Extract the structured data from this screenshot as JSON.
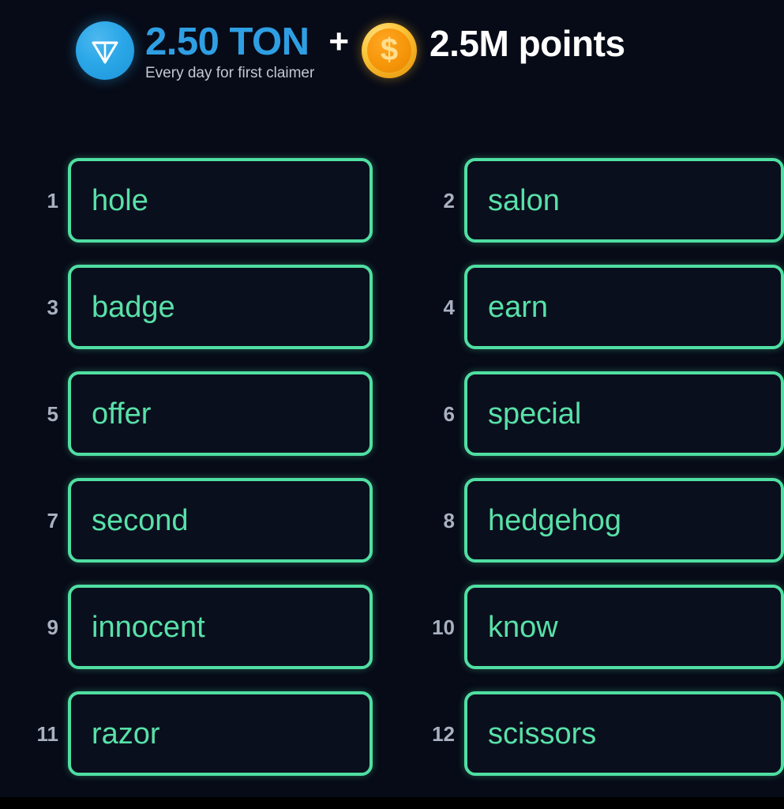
{
  "banner": {
    "ton_icon": "ton-coin-icon",
    "ton_amount": "2.50 TON",
    "ton_subtitle": "Every day for first claimer",
    "plus": "+",
    "coin_icon": "gold-coin-icon",
    "coin_symbol": "$",
    "points_amount": "2.5M points",
    "colors": {
      "ton_blue": "#2f9fe4",
      "coin_gold": "#f5a81a",
      "points_white": "#ffffff",
      "subtitle_gray": "#c3c8d4"
    }
  },
  "grid": {
    "accent_green": "#4fdfa2",
    "text_green": "#58e1a8",
    "index_gray": "#a9b0c0",
    "background": "#070b17",
    "rows": [
      {
        "left": {
          "index": "1",
          "word": "hole"
        },
        "right": {
          "index": "2",
          "word": "salon"
        }
      },
      {
        "left": {
          "index": "3",
          "word": "badge"
        },
        "right": {
          "index": "4",
          "word": "earn"
        }
      },
      {
        "left": {
          "index": "5",
          "word": "offer"
        },
        "right": {
          "index": "6",
          "word": "special"
        }
      },
      {
        "left": {
          "index": "7",
          "word": "second"
        },
        "right": {
          "index": "8",
          "word": "hedgehog"
        }
      },
      {
        "left": {
          "index": "9",
          "word": "innocent"
        },
        "right": {
          "index": "10",
          "word": "know"
        }
      },
      {
        "left": {
          "index": "11",
          "word": "razor"
        },
        "right": {
          "index": "12",
          "word": "scissors"
        }
      }
    ]
  }
}
